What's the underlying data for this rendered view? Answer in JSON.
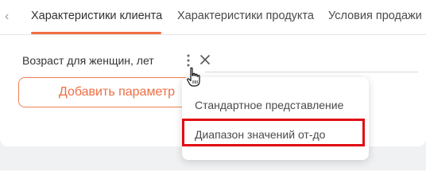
{
  "tabs": [
    {
      "label": "Характеристики клиента",
      "active": true
    },
    {
      "label": "Характеристики продукта",
      "active": false
    },
    {
      "label": "Условия продажи",
      "active": false
    }
  ],
  "parameter": {
    "label": "Возраст для женщин, лет"
  },
  "add_button": {
    "label": "Добавить параметр"
  },
  "dropdown": {
    "options": [
      {
        "label": "Стандартное представление"
      },
      {
        "label": "Диапазон значений от-до",
        "highlighted": true
      }
    ]
  },
  "icons": {
    "prev": "chevron-left-icon",
    "menu": "kebab-icon",
    "remove": "close-icon",
    "pointer": "hand-cursor-icon"
  },
  "colors": {
    "accent": "#ee6e44",
    "highlight": "#e10b14"
  }
}
